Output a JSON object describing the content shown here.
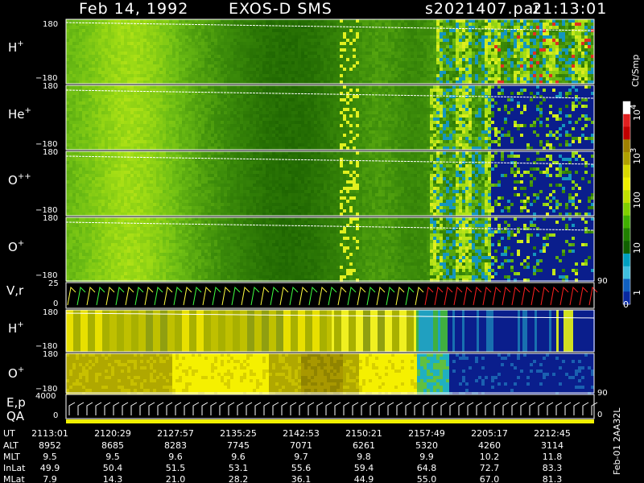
{
  "header": {
    "date": "Feb 14, 1992",
    "instrument": "EXOS-D SMS",
    "file": "s2021407.par",
    "time": "21:13:01"
  },
  "colors": {
    "background": "#000000",
    "spectrogram_low": "#2c6f00",
    "spectrogram_mid": "#99d800",
    "spectrogram_high": "#f2f200",
    "spectrogram_deep": "#0b1f8c",
    "vr_left": "#ffff00",
    "vr_right": "#ff2020"
  },
  "panels": [
    {
      "id": "H",
      "base": "H",
      "sup": "+",
      "ymax": "180",
      "ymin": "−180"
    },
    {
      "id": "He",
      "base": "He",
      "sup": "+",
      "ymax": "180",
      "ymin": "−180"
    },
    {
      "id": "O2",
      "base": "O",
      "sup": "++",
      "ymax": "180",
      "ymin": "−180"
    },
    {
      "id": "O",
      "base": "O",
      "sup": "+",
      "ymax": "180",
      "ymin": "−180",
      "right_label": "90"
    },
    {
      "id": "Vr",
      "base": "V,r",
      "sup": "",
      "ymax": "25",
      "ymin": "0"
    },
    {
      "id": "H2",
      "base": "H",
      "sup": "+",
      "ymax": "180",
      "ymin": "−180"
    },
    {
      "id": "O3",
      "base": "O",
      "sup": "+",
      "ymax": "180",
      "ymin": "−180",
      "right_label": "90"
    },
    {
      "id": "Ep",
      "base": "E,p",
      "sup": "",
      "ymax": "4000",
      "ymin": "0",
      "right_label": "0"
    },
    {
      "id": "QA",
      "base": "QA",
      "sup": "",
      "ymax": "",
      "ymin": ""
    }
  ],
  "colorbar": {
    "unit": "Ct/Smp",
    "ticks": [
      {
        "base": "10",
        "exp": "4",
        "value": 10000
      },
      {
        "base": "10",
        "exp": "3",
        "value": 1000
      },
      {
        "base": "100",
        "exp": "",
        "value": 100
      },
      {
        "base": "10",
        "exp": "",
        "value": 10
      },
      {
        "base": "1",
        "exp": "",
        "value": 1
      }
    ],
    "bottom_value": "0"
  },
  "chart_data": {
    "type": "heatmap",
    "title": "Feb 14, 1992 EXOS-D SMS",
    "x": {
      "quantity": "UT",
      "ticks": [
        "2113:01",
        "2120:29",
        "2127:57",
        "2135:25",
        "2142:53",
        "2150:21",
        "2157:49",
        "2205:17",
        "2212:45"
      ]
    },
    "ephemeris": [
      {
        "label": "UT",
        "values": [
          "2113:01",
          "2120:29",
          "2127:57",
          "2135:25",
          "2142:53",
          "2150:21",
          "2157:49",
          "2205:17",
          "2212:45"
        ]
      },
      {
        "label": "ALT",
        "values": [
          "8952",
          "8685",
          "8283",
          "7745",
          "7071",
          "6261",
          "5320",
          "4260",
          "3114"
        ]
      },
      {
        "label": "MLT",
        "values": [
          "9.5",
          "9.5",
          "9.6",
          "9.6",
          "9.7",
          "9.8",
          "9.9",
          "10.2",
          "11.8"
        ]
      },
      {
        "label": "InLat",
        "values": [
          "49.9",
          "50.4",
          "51.5",
          "53.1",
          "55.6",
          "59.4",
          "64.8",
          "72.7",
          "83.3"
        ]
      },
      {
        "label": "MLat",
        "values": [
          "7.9",
          "14.3",
          "21.0",
          "28.2",
          "36.1",
          "44.9",
          "55.0",
          "67.0",
          "81.3"
        ]
      }
    ],
    "y_range_pitch": [
      -180,
      180
    ],
    "colorscale_log": true,
    "colorscale_range": [
      1,
      10000
    ],
    "side_label": "Feb-01 2AA32L"
  }
}
